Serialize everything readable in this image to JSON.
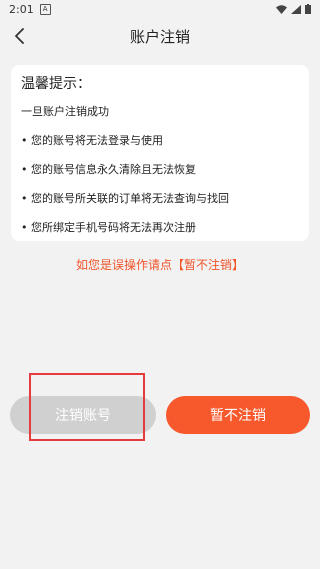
{
  "status_bar": {
    "time": "2:01",
    "notif_icon": "A"
  },
  "header": {
    "title": "账户注销",
    "back_icon": "chevron-left-icon"
  },
  "card": {
    "title": "温馨提示：",
    "lines": [
      "一旦账户注销成功",
      "• 您的账号将无法登录与使用",
      "• 您的账号信息永久清除且无法恢复",
      "• 您的账号所关联的订单将无法查询与找回",
      "• 您所绑定手机号码将无法再次注册"
    ]
  },
  "notice": "如您是误操作请点【暂不注销】",
  "buttons": {
    "cancel_account": "注销账号",
    "keep": "暂不注销"
  },
  "colors": {
    "accent": "#f7582c",
    "notice": "#f0542a",
    "disabled": "#d0d0d0",
    "highlight": "#e53b3b"
  }
}
